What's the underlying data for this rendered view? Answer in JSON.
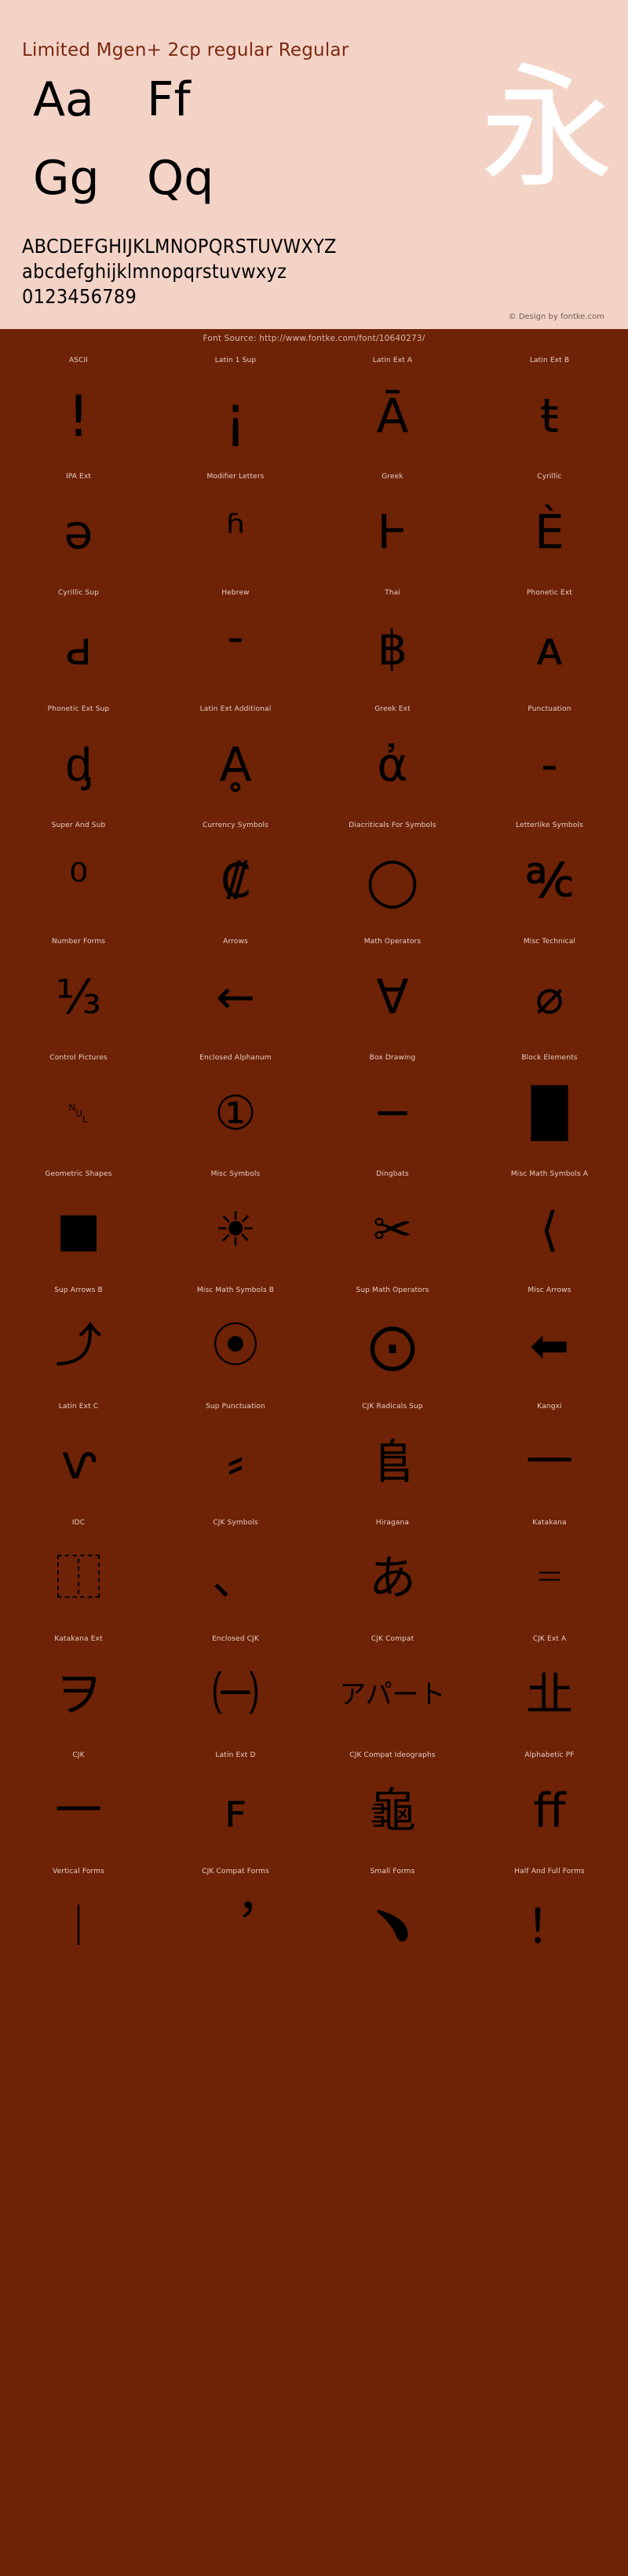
{
  "header": {
    "title": "Limited Mgen+ 2cp regular Regular",
    "big_samples": [
      {
        "glyph": "Aa"
      },
      {
        "glyph": "Ff"
      },
      {
        "glyph": "Gg"
      },
      {
        "glyph": "Qq"
      }
    ],
    "cjk_sample": "永",
    "alphabet_upper": "ABCDEFGHIJKLMNOPQRSTUVWXYZ",
    "alphabet_lower": "abcdefghijklmnopqrstuvwxyz",
    "digits": "0123456789",
    "credit": "© Design by fontke.com",
    "font_source": "Font Source: http://www.fontke.com/font/10640273/"
  },
  "colors": {
    "header_bg": "#f4d3c7",
    "body_bg": "#6e2206",
    "title_text": "#7a2910",
    "glyph_black": "#000000",
    "cjk_white": "#ffffff",
    "label_text": "#e7cfc6",
    "credit_text": "#6d5a52"
  },
  "blocks": [
    {
      "label": "ASCII",
      "glyph": "!",
      "size": "lg"
    },
    {
      "label": "Latin 1 Sup",
      "glyph": "¡",
      "size": "lg"
    },
    {
      "label": "Latin Ext A",
      "glyph": "Ā",
      "size": ""
    },
    {
      "label": "Latin Ext B",
      "glyph": "ŧ",
      "size": ""
    },
    {
      "label": "IPA Ext",
      "glyph": "ǝ",
      "size": ""
    },
    {
      "label": "Modifier Letters",
      "glyph": "ʱ",
      "size": ""
    },
    {
      "label": "Greek",
      "glyph": "Ͱ",
      "size": ""
    },
    {
      "label": "Cyrillic",
      "glyph": "È",
      "size": ""
    },
    {
      "label": "Cyrillic Sup",
      "glyph": "ԁ",
      "size": ""
    },
    {
      "label": "Hebrew",
      "glyph": "־",
      "size": ""
    },
    {
      "label": "Thai",
      "glyph": "฿",
      "size": ""
    },
    {
      "label": "Phonetic Ext",
      "glyph": "ᴀ",
      "size": ""
    },
    {
      "label": "Phonetic Ext Sup",
      "glyph": "ᶁ",
      "size": ""
    },
    {
      "label": "Latin Ext Additional",
      "glyph": "Ḁ",
      "size": ""
    },
    {
      "label": "Greek Ext",
      "glyph": "ἀ",
      "size": ""
    },
    {
      "label": "Punctuation",
      "glyph": "‐",
      "size": ""
    },
    {
      "label": "Super And Sub",
      "glyph": "⁰",
      "size": ""
    },
    {
      "label": "Currency Symbols",
      "glyph": "₡",
      "size": ""
    },
    {
      "label": "Diacriticals For Symbols",
      "glyph": "◯",
      "size": ""
    },
    {
      "label": "Letterlike Symbols",
      "glyph": "℀",
      "size": ""
    },
    {
      "label": "Number Forms",
      "glyph": "⅓",
      "size": ""
    },
    {
      "label": "Arrows",
      "glyph": "←",
      "size": ""
    },
    {
      "label": "Math Operators",
      "glyph": "∀",
      "size": ""
    },
    {
      "label": "Misc Technical",
      "glyph": "⌀",
      "size": ""
    },
    {
      "label": "Control Pictures",
      "glyph": "␀",
      "size": "xs"
    },
    {
      "label": "Enclosed Alphanum",
      "glyph": "①",
      "size": ""
    },
    {
      "label": "Box Drawing",
      "glyph": "─",
      "size": ""
    },
    {
      "label": "Block Elements",
      "glyph": "█",
      "size": ""
    },
    {
      "label": "Geometric Shapes",
      "glyph": "■",
      "size": ""
    },
    {
      "label": "Misc Symbols",
      "glyph": "☀",
      "size": ""
    },
    {
      "label": "Dingbats",
      "glyph": "✂",
      "size": ""
    },
    {
      "label": "Misc Math Symbols A",
      "glyph": "⟨",
      "size": ""
    },
    {
      "label": "Sup Arrows B",
      "glyph": "⤴",
      "size": ""
    },
    {
      "label": "Misc Math Symbols B",
      "glyph": "⦿",
      "size": ""
    },
    {
      "label": "Sup Math Operators",
      "glyph": "⨀",
      "size": ""
    },
    {
      "label": "Misc Arrows",
      "glyph": "⬅",
      "size": ""
    },
    {
      "label": "Latin Ext C",
      "glyph": "ⱱ",
      "size": ""
    },
    {
      "label": "Sup Punctuation",
      "glyph": "⸗",
      "size": ""
    },
    {
      "label": "CJK Radicals Sup",
      "glyph": "⻕",
      "size": ""
    },
    {
      "label": "Kangxi",
      "glyph": "一",
      "size": ""
    },
    {
      "label": "IDC",
      "glyph": "⿰",
      "size": ""
    },
    {
      "label": "CJK Symbols",
      "glyph": "、",
      "size": ""
    },
    {
      "label": "Hiragana",
      "glyph": "あ",
      "size": ""
    },
    {
      "label": "Katakana",
      "glyph": "゠",
      "size": ""
    },
    {
      "label": "Katakana Ext",
      "glyph": "ヲ",
      "size": ""
    },
    {
      "label": "Enclosed CJK",
      "glyph": "㈠",
      "size": ""
    },
    {
      "label": "CJK Compat",
      "glyph": "アパート",
      "size": "xs"
    },
    {
      "label": "CJK Ext A",
      "glyph": "㐀",
      "size": ""
    },
    {
      "label": "CJK",
      "glyph": "一",
      "size": ""
    },
    {
      "label": "Latin Ext D",
      "glyph": "ꜰ",
      "size": ""
    },
    {
      "label": "CJK Compat Ideographs",
      "glyph": "龜",
      "size": ""
    },
    {
      "label": "Alphabetic PF",
      "glyph": "ﬀ",
      "size": ""
    },
    {
      "label": "Vertical Forms",
      "glyph": "︱",
      "size": ""
    },
    {
      "label": "CJK Compat Forms",
      "glyph": "︐",
      "size": ""
    },
    {
      "label": "Small Forms",
      "glyph": "﹅",
      "size": ""
    },
    {
      "label": "Half And Full Forms",
      "glyph": "！",
      "size": ""
    }
  ]
}
